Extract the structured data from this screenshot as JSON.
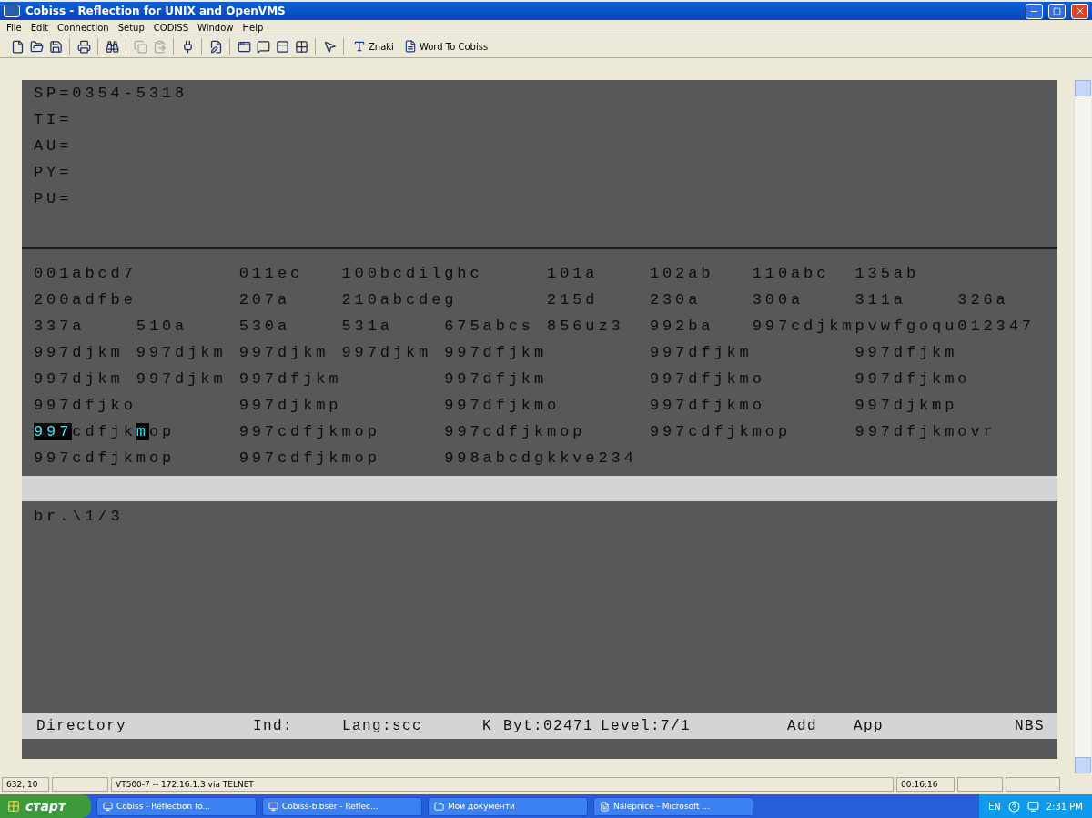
{
  "window": {
    "title": "Cobiss - Reflection for UNIX and OpenVMS"
  },
  "menu": [
    "File",
    "Edit",
    "Connection",
    "Setup",
    "CODISS",
    "Window",
    "Help"
  ],
  "toolbar": {
    "buttons": [
      {
        "label": "Znaki"
      },
      {
        "label": "Word To Cobiss"
      }
    ]
  },
  "terminal": {
    "header_lines": [
      "SP=0354-5318",
      "TI=",
      "AU=",
      "PY=",
      "PU="
    ],
    "data_lines": [
      [
        {
          "text": "001abcd7        011ec   100bcdilghc     101a    102ab   110abc  135ab",
          "highlighted": false
        }
      ],
      [
        {
          "text": "200adfbe        207a    210abcdeg       215d    230a    300a    311a    326a",
          "highlighted": false
        }
      ],
      [
        {
          "text": "337a    510a    530a    531a    675abcs 856uz3  992ba   997cdjkmpvwfgoqu012347",
          "highlighted": false
        }
      ],
      [
        {
          "text": "997djkm 997djkm 997djkm 997djkm 997dfjkm        997dfjkm        997dfjkm",
          "highlighted": false
        }
      ],
      [
        {
          "text": "997djkm 997djkm 997dfjkm        997dfjkm        997dfjkmo       997dfjkmo",
          "highlighted": false
        }
      ],
      [
        {
          "text": "997dfjko        997djkmp        997dfjkmo       997dfjkmo       997djkmp",
          "highlighted": false
        }
      ],
      [
        {
          "text": "997",
          "highlighted": true
        },
        {
          "text": "cdfjk",
          "highlighted": false
        },
        {
          "text": "m",
          "highlighted": true
        },
        {
          "text": "op     997cdfjkmop     997cdfjkmop     997cdfjkmop     997dfjkmovr",
          "highlighted": false
        }
      ],
      [
        {
          "text": "997cdfjkmop     997cdfjkmop     998abcdgkkve234",
          "highlighted": false
        }
      ]
    ],
    "message": "br.\\1/3",
    "status_line": [
      "Directory",
      "Ind:",
      "Lang:scc",
      "K",
      "Byt:02471",
      "Level:7/1",
      "Add",
      "App",
      "NBS"
    ]
  },
  "status_bar": {
    "position": "632, 10",
    "connection": "VT500-7 -- 172.16.1.3 via TELNET",
    "timer": "00:16:16"
  },
  "taskbar": {
    "start": "старт",
    "tasks": [
      "Cobiss - Reflection fo...",
      "Cobiss-bibser - Reflec...",
      "Мои документи",
      "Nalepnice - Microsoft ..."
    ],
    "language": "EN",
    "clock": "2:31 PM"
  }
}
